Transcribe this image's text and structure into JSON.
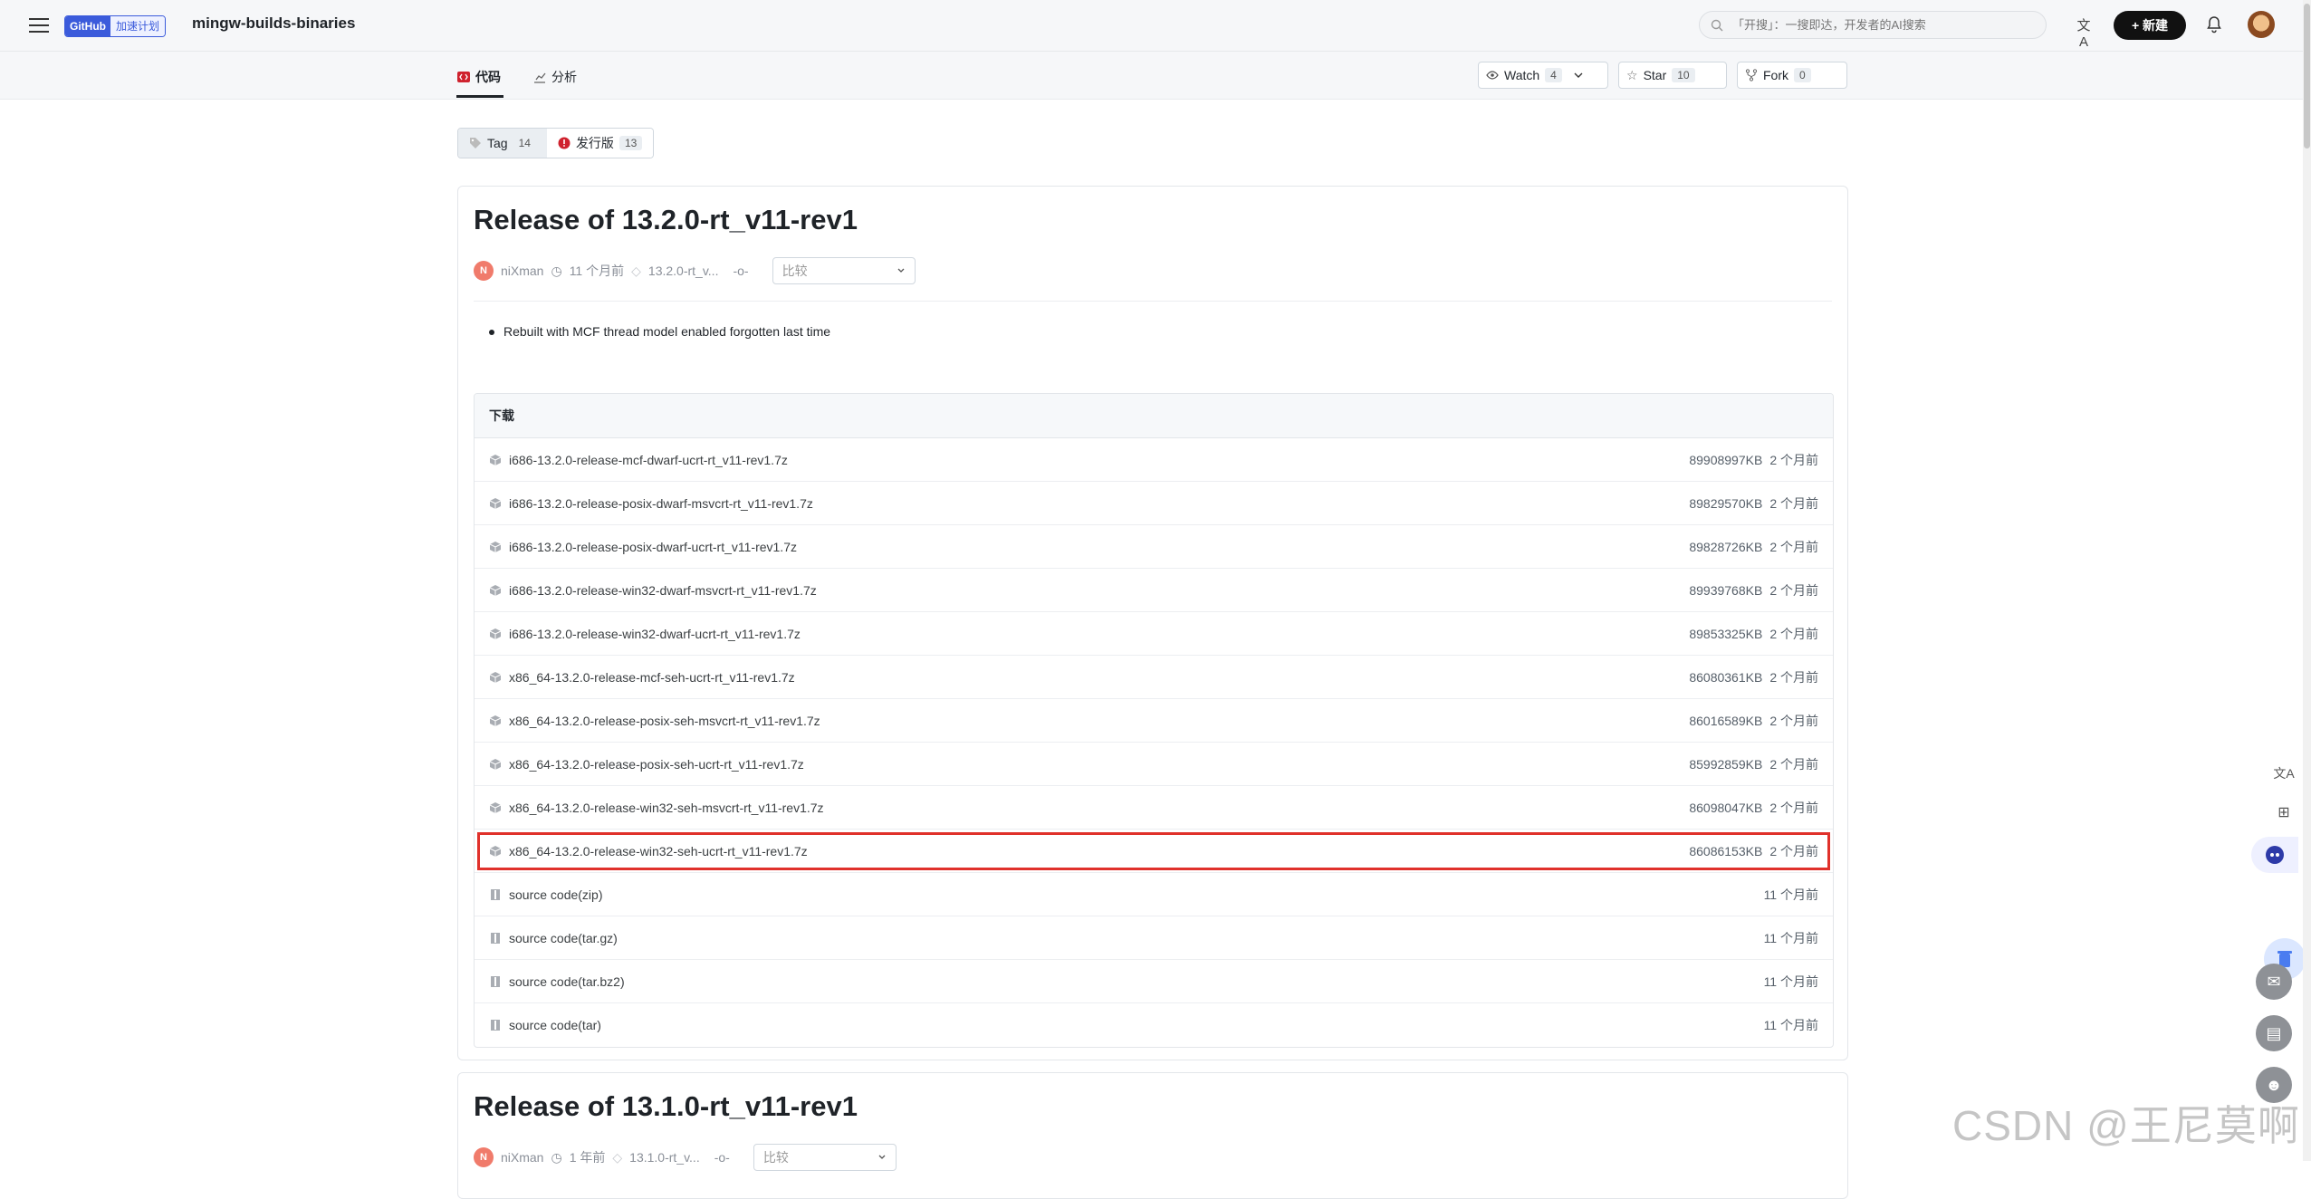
{
  "header": {
    "badge_primary": "GitHub",
    "badge_secondary": "加速计划",
    "repo_name": "mingw-builds-binaries",
    "search_placeholder": "「开搜」：一搜即达，开发者的AI搜索",
    "new_label": "+ 新建"
  },
  "subnav": {
    "tabs": [
      {
        "label": "代码",
        "icon": "code-icon",
        "active": true
      },
      {
        "label": "分析",
        "icon": "chart-icon",
        "active": false
      }
    ],
    "watch": {
      "label": "Watch",
      "count": "4"
    },
    "star": {
      "label": "Star",
      "count": "10"
    },
    "fork": {
      "label": "Fork",
      "count": "0"
    }
  },
  "filter": {
    "tag": {
      "label": "Tag",
      "count": "14"
    },
    "release": {
      "label": "发行版",
      "count": "13"
    }
  },
  "releases": [
    {
      "title": "Release of 13.2.0-rt_v11-rev1",
      "author_initial": "N",
      "author": "niXman",
      "time": "11 个月前",
      "tag": "13.2.0-rt_v...",
      "compare_label": "比较",
      "notes": [
        "Rebuilt with MCF thread model enabled forgotten last time"
      ],
      "downloads_header": "下载",
      "downloads": [
        {
          "name": "i686-13.2.0-release-mcf-dwarf-ucrt-rt_v11-rev1.7z",
          "size": "89908997KB",
          "time": "2 个月前"
        },
        {
          "name": "i686-13.2.0-release-posix-dwarf-msvcrt-rt_v11-rev1.7z",
          "size": "89829570KB",
          "time": "2 个月前"
        },
        {
          "name": "i686-13.2.0-release-posix-dwarf-ucrt-rt_v11-rev1.7z",
          "size": "89828726KB",
          "time": "2 个月前"
        },
        {
          "name": "i686-13.2.0-release-win32-dwarf-msvcrt-rt_v11-rev1.7z",
          "size": "89939768KB",
          "time": "2 个月前"
        },
        {
          "name": "i686-13.2.0-release-win32-dwarf-ucrt-rt_v11-rev1.7z",
          "size": "89853325KB",
          "time": "2 个月前"
        },
        {
          "name": "x86_64-13.2.0-release-mcf-seh-ucrt-rt_v11-rev1.7z",
          "size": "86080361KB",
          "time": "2 个月前"
        },
        {
          "name": "x86_64-13.2.0-release-posix-seh-msvcrt-rt_v11-rev1.7z",
          "size": "86016589KB",
          "time": "2 个月前"
        },
        {
          "name": "x86_64-13.2.0-release-posix-seh-ucrt-rt_v11-rev1.7z",
          "size": "85992859KB",
          "time": "2 个月前"
        },
        {
          "name": "x86_64-13.2.0-release-win32-seh-msvcrt-rt_v11-rev1.7z",
          "size": "86098047KB",
          "time": "2 个月前"
        },
        {
          "name": "x86_64-13.2.0-release-win32-seh-ucrt-rt_v11-rev1.7z",
          "size": "86086153KB",
          "time": "2 个月前",
          "highlighted": true
        },
        {
          "name": "source code(zip)",
          "size": "",
          "time": "11 个月前",
          "source": true
        },
        {
          "name": "source code(tar.gz)",
          "size": "",
          "time": "11 个月前",
          "source": true
        },
        {
          "name": "source code(tar.bz2)",
          "size": "",
          "time": "11 个月前",
          "source": true
        },
        {
          "name": "source code(tar)",
          "size": "",
          "time": "11 个月前",
          "source": true
        }
      ]
    },
    {
      "title": "Release of 13.1.0-rt_v11-rev1",
      "author_initial": "N",
      "author": "niXman",
      "time": "1 年前",
      "tag": "13.1.0-rt_v...",
      "compare_label": "比较"
    }
  ],
  "watermark": "CSDN @王尼莫啊",
  "colors": {
    "highlight": "#e0312b",
    "badge": "#3b5bdb",
    "release_icon": "#cf222e"
  }
}
